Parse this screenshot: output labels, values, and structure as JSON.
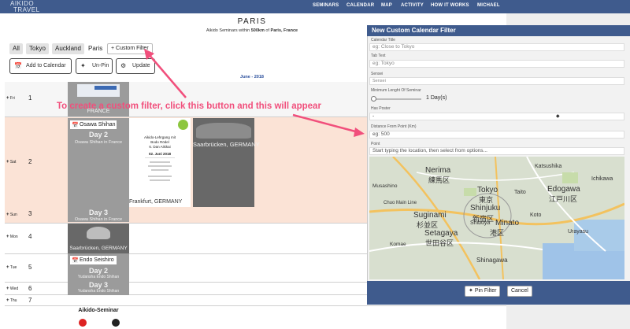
{
  "brand": {
    "logo_line1": "AIKIDO",
    "logo_line2": "TRAVEL"
  },
  "nav": {
    "items": [
      "SEMINARS",
      "CALENDAR",
      "MAP",
      "ACTIVITY",
      "HOW IT WORKS",
      "MICHAEL"
    ]
  },
  "header": {
    "title": "PARIS",
    "subtitle_prefix": "Aikido Seminars within ",
    "subtitle_distance": "500km",
    "subtitle_mid": " of ",
    "subtitle_place": "Paris, France"
  },
  "tabs": [
    "All",
    "Tokyo",
    "Auckland",
    "Paris",
    "+ Custom Filter"
  ],
  "actions": {
    "add_calendar": "Add to Calendar",
    "unpin": "Un-Pin",
    "update": "Update"
  },
  "calendar": {
    "month": "June - 2018",
    "days": [
      {
        "wd": "Fri",
        "num": "1"
      },
      {
        "wd": "Sat",
        "num": "2"
      },
      {
        "wd": "Sun",
        "num": "3"
      },
      {
        "wd": "Mon",
        "num": "4"
      },
      {
        "wd": "Tue",
        "num": "5"
      },
      {
        "wd": "Wed",
        "num": "6"
      },
      {
        "wd": "Thu",
        "num": "7"
      }
    ],
    "cards": {
      "france_label": "FRANCE",
      "osawa": {
        "name": "Osawa Shihan",
        "day2": "Day 2",
        "sub2": "Osawa Shihan in France",
        "day3": "Day 3",
        "sub3": "Osawa Shihan in France"
      },
      "poster": {
        "l1": "Aikido-Lehrgang mit",
        "l2": "Bodo Rödel",
        "l3": "6. Dan Aikikai",
        "l4": "02. Juni 2018",
        "location": "Frankfurt, GERMANY"
      },
      "saar_label": "Saarbrücken, GERMANY",
      "saar2_label": "Saarbrücken, GERMANY",
      "endo": {
        "name": "Endo Seishiro",
        "day2": "Day 2",
        "sub2": "Yudansha Endo Shihan",
        "day3": "Day 3",
        "sub3": "Yudansha Endo Shihan"
      },
      "bottom_poster": "Aikido-Seminar"
    }
  },
  "annotation": "To create a custom filter, click this button and this will appear",
  "filter_panel": {
    "title": "New Custom Calendar Filter",
    "fields": [
      {
        "label": "Calendar Title",
        "placeholder": "eg: Close to Tokyo"
      },
      {
        "label": "Tab Text",
        "placeholder": "eg: Tokyo"
      },
      {
        "label": "Sensei",
        "placeholder": "Sensei"
      },
      {
        "label": "Minimum Lenght Of Seminar",
        "value": "1 Day(s)"
      },
      {
        "label": "Has Poster",
        "value": "-"
      },
      {
        "label": "Distance From Point (Km)",
        "placeholder": "eg: 500"
      },
      {
        "label": "Point",
        "placeholder": "Start typing the location, then select from options..."
      }
    ],
    "buttons": {
      "pin": "Pin Filter",
      "cancel": "Cancel"
    },
    "map_labels": [
      "Nerima",
      "練馬区",
      "Tokyo",
      "東京",
      "Shinjuku",
      "新宿区",
      "Suginami",
      "杉並区",
      "Setagaya",
      "世田谷区",
      "Minato",
      "港区",
      "Edogawa",
      "江戸川区",
      "Katsushika",
      "Shinagawa",
      "Musashino",
      "Koto",
      "Taito",
      "Urayasu",
      "Chuo Main Line",
      "Komae",
      "Ichikawa",
      "Shibuya"
    ]
  },
  "colors": {
    "navy": "#3f5b8d",
    "highlight": "#fbe3d6",
    "annotation": "#f14f7c"
  }
}
